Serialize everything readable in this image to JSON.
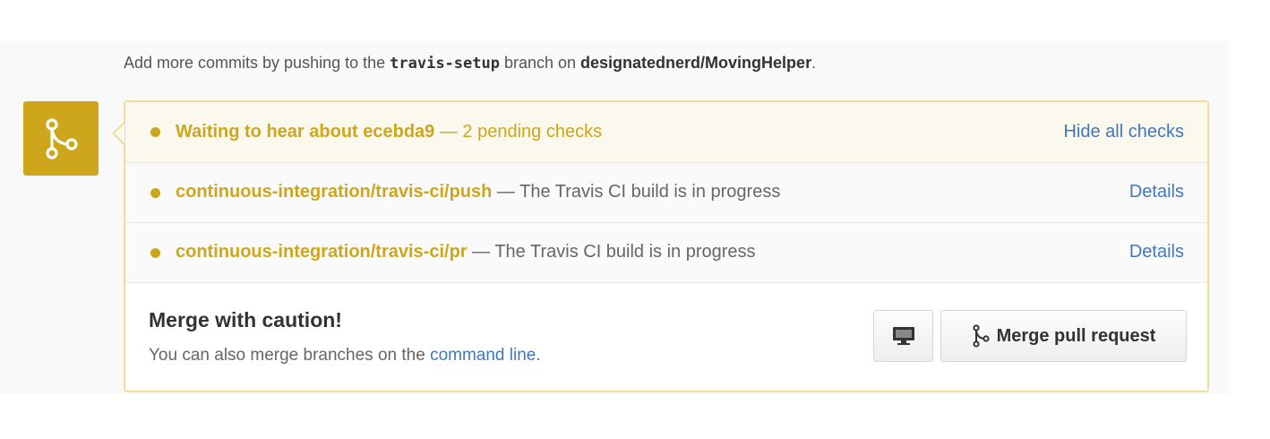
{
  "header": {
    "prefix": "Add more commits by pushing to the ",
    "branch": "travis-setup",
    "middle": " branch on ",
    "repo": "designatednerd/MovingHelper",
    "suffix": "."
  },
  "status_icon": "git-merge-icon",
  "summary": {
    "title": "Waiting to hear about ecebda9",
    "pending": " — 2 pending checks",
    "toggle_label": "Hide all checks"
  },
  "checks": [
    {
      "name": "continuous-integration/travis-ci/push",
      "description": " — The Travis CI build is in progress",
      "link_label": "Details"
    },
    {
      "name": "continuous-integration/travis-ci/pr",
      "description": " — The Travis CI build is in progress",
      "link_label": "Details"
    }
  ],
  "merge": {
    "title": "Merge with caution!",
    "sub_prefix": "You can also merge branches on the ",
    "sub_link": "command line",
    "sub_suffix": ".",
    "desktop_icon": "desktop-icon",
    "button_icon": "git-merge-icon",
    "button_label": "Merge pull request"
  },
  "colors": {
    "pending": "#cea61b",
    "link": "#4078c0",
    "panel_border": "#f0dc9b"
  }
}
